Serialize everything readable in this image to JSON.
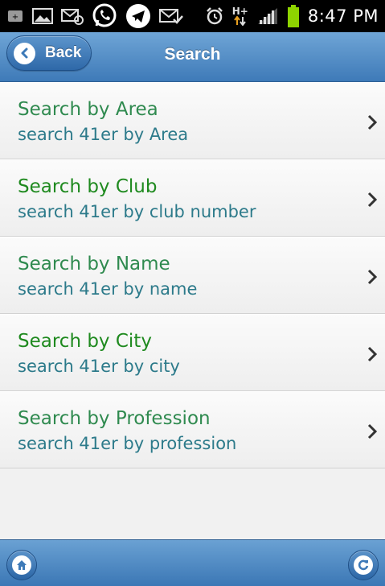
{
  "status_bar": {
    "time": "8:47 PM",
    "network_label": "H+",
    "icons": [
      "notification-icon",
      "gallery-icon",
      "email-icon",
      "whatsapp-icon",
      "telegram-icon",
      "mail-check-icon",
      "alarm-icon",
      "network-icon",
      "signal-icon",
      "battery-icon"
    ]
  },
  "header": {
    "back_label": "Back",
    "title": "Search"
  },
  "list": {
    "items": [
      {
        "title": "Search by Area",
        "subtitle": "search 41er by Area",
        "title_color": "#2f8a4f"
      },
      {
        "title": "Search by Club",
        "subtitle": "search 41er by club number",
        "title_color": "#1f8a1f"
      },
      {
        "title": "Search by Name",
        "subtitle": "search 41er by name",
        "title_color": "#2f8a4f"
      },
      {
        "title": "Search by City",
        "subtitle": "search 41er by city",
        "title_color": "#1f8a1f"
      },
      {
        "title": "Search by Profession",
        "subtitle": "search 41er by profession",
        "title_color": "#2f8a4f"
      }
    ]
  },
  "footer": {
    "left_icon": "home-icon",
    "right_icon": "refresh-icon"
  },
  "colors": {
    "header_top": "#6fa5d6",
    "header_bottom": "#3e7ab8",
    "subtitle": "#2c7a8a",
    "battery": "#8ed400"
  }
}
